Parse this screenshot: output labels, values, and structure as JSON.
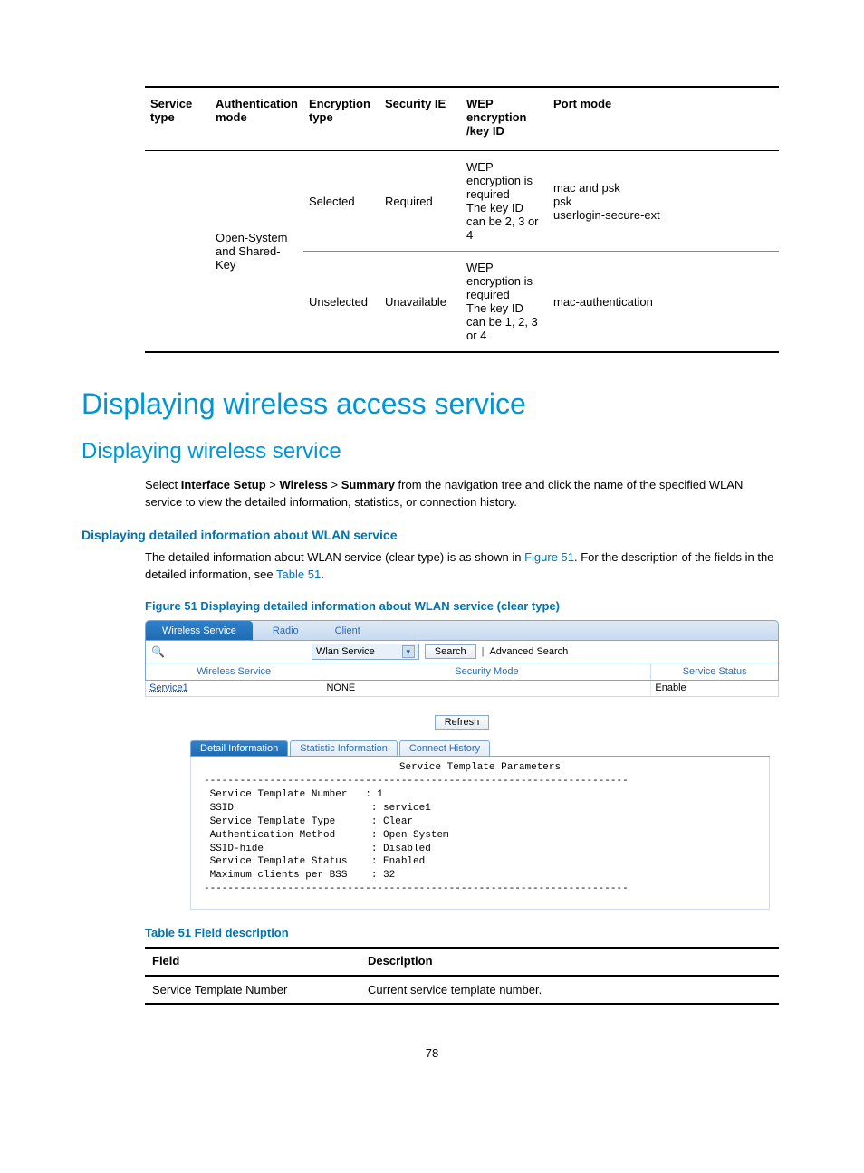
{
  "topTable": {
    "headers": [
      "Service type",
      "Authentication mode",
      "Encryption type",
      "Security IE",
      "WEP encryption /key ID",
      "Port mode"
    ],
    "authModeSpan": "Open-System and Shared-Key",
    "rows": [
      {
        "enc": "Selected",
        "secIE": "Required",
        "wep": "WEP encryption is required\nThe key ID can be 2, 3 or 4",
        "port": "mac and psk\npsk\nuserlogin-secure-ext"
      },
      {
        "enc": "Unselected",
        "secIE": "Unavailable",
        "wep": "WEP encryption is required\nThe key ID can be 1, 2, 3 or 4",
        "port": "mac-authentication"
      }
    ]
  },
  "h1": "Displaying wireless access service",
  "h2": "Displaying wireless service",
  "navText": {
    "prefix": "Select ",
    "p1": "Interface Setup",
    "sep": " > ",
    "p2": "Wireless",
    "p3": "Summary",
    "rest": " from the navigation tree and click the name of the specified WLAN service to view the detailed information, statistics, or connection history."
  },
  "minorHeading": "Displaying detailed information about WLAN service",
  "detailPara": {
    "pre": "The detailed information about WLAN service (clear type) is as shown in ",
    "figLink": "Figure 51",
    "mid": ". For the description of the fields in the detailed information, see ",
    "tblLink": "Table 51",
    "post": "."
  },
  "figCaption": "Figure 51 Displaying detailed information about WLAN service (clear type)",
  "ui": {
    "tabs": [
      "Wireless Service",
      "Radio",
      "Client"
    ],
    "dropdownValue": "Wlan Service",
    "searchBtn": "Search",
    "advSearch": "Advanced Search",
    "headers": [
      "Wireless Service",
      "Security Mode",
      "Service Status"
    ],
    "row": {
      "svc": "Service1",
      "mode": "NONE",
      "status": "Enable"
    },
    "refreshBtn": "Refresh",
    "subtabs": [
      "Detail Information",
      "Statistic Information",
      "Connect History"
    ],
    "detailTitle": "Service Template Parameters",
    "detailBody": "-----------------------------------------------------------------------\n Service Template Number   : 1\n SSID                       : service1\n Service Template Type      : Clear\n Authentication Method      : Open System\n SSID-hide                  : Disabled\n Service Template Status    : Enabled\n Maximum clients per BSS    : 32\n-----------------------------------------------------------------------"
  },
  "tableCaption": "Table 51 Field description",
  "fieldTable": {
    "headers": [
      "Field",
      "Description"
    ],
    "rows": [
      {
        "f": "Service Template Number",
        "d": "Current service template number."
      }
    ]
  },
  "pageNumber": "78"
}
